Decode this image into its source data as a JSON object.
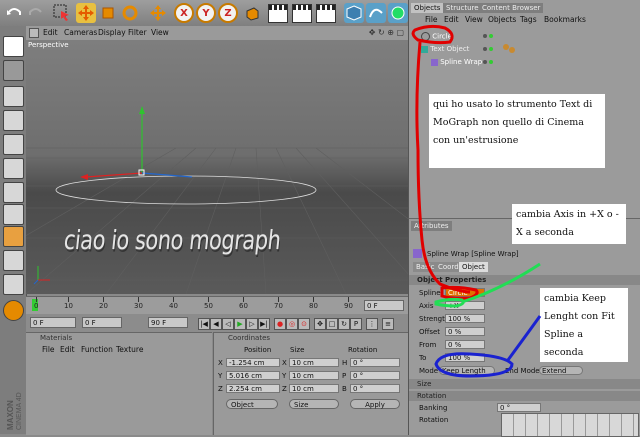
{
  "toolbar": {
    "axis_buttons": [
      "X",
      "Y",
      "Z"
    ]
  },
  "viewport": {
    "menu": [
      "Edit",
      "Cameras",
      "Display",
      "Filter",
      "View"
    ],
    "label": "Perspective",
    "object_text": "ciao io sono mograph"
  },
  "timeline": {
    "ticks": [
      "0",
      "10",
      "20",
      "30",
      "40",
      "50",
      "60",
      "70",
      "80",
      "90"
    ],
    "end_frame": "0 F",
    "current": "0 F",
    "start": "0 F",
    "end": "90 F"
  },
  "materials": {
    "title": "Materials",
    "menu": [
      "File",
      "Edit",
      "Function",
      "Texture"
    ]
  },
  "coordinates": {
    "title": "Coordinates",
    "headers": [
      "Position",
      "Size",
      "Rotation"
    ],
    "rows": [
      {
        "axis": "X",
        "pos": "-1.254 cm",
        "size": "10 cm",
        "rot_lbl": "H",
        "rot": "0 °"
      },
      {
        "axis": "Y",
        "pos": "5.016 cm",
        "size": "10 cm",
        "rot_lbl": "P",
        "rot": "0 °"
      },
      {
        "axis": "Z",
        "pos": "2.254 cm",
        "size": "10 cm",
        "rot_lbl": "B",
        "rot": "0 °"
      }
    ],
    "mode_object": "Object",
    "mode_size": "Size",
    "apply": "Apply"
  },
  "objects_panel": {
    "tabs": [
      "Objects",
      "Structure",
      "Content Browser"
    ],
    "menu": [
      "File",
      "Edit",
      "View",
      "Objects",
      "Tags",
      "Bookmarks"
    ],
    "items": [
      "Circle",
      "Text Object",
      "Spline Wrap"
    ]
  },
  "attributes": {
    "tab": "Attributes",
    "title": "Spline Wrap [Spline Wrap]",
    "subtabs": [
      "Basic",
      "Coord.",
      "Object"
    ],
    "section": "Object Properties",
    "fields": [
      {
        "label": "Spline",
        "value": "Circle"
      },
      {
        "label": "Axis",
        "value": "+X"
      },
      {
        "label": "Strength",
        "value": "100 %"
      },
      {
        "label": "Offset",
        "value": "0 %"
      },
      {
        "label": "From",
        "value": "0 %"
      },
      {
        "label": "To",
        "value": "100 %"
      }
    ],
    "mode_label": "Mode",
    "mode_value": "Keep Length",
    "end_mode_label": "End Mode",
    "end_mode_value": "Extend",
    "size_section": "Size",
    "rotation_section": "Rotation",
    "banking_label": "Banking",
    "banking_value": "0 °",
    "rotation_label": "Rotation"
  },
  "notes": {
    "note1": "qui ho usato lo strumento Text di MoGraph non quello di Cinema con un'estrusione",
    "note2": "cambia Axis in +X o -X a seconda",
    "note3": "cambia Keep Lenght con Fit Spline a seconda"
  },
  "branding": "MAXON CINEMA 4D",
  "colors": {
    "annotation_red": "#e00000",
    "annotation_green": "#22dd55",
    "annotation_blue": "#1a22d0",
    "selection_orange": "#e07000"
  }
}
